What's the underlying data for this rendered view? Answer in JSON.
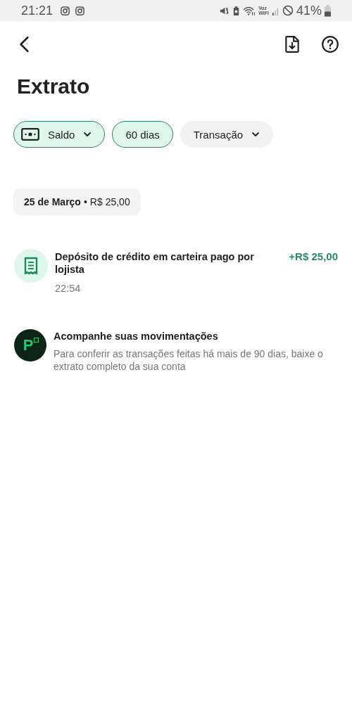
{
  "status_bar": {
    "time": "21:21",
    "network_label_top": "Voz",
    "network_label_bottom": "WIFI",
    "battery": "41%"
  },
  "header": {
    "title": "Extrato"
  },
  "filters": [
    {
      "kind": "balance",
      "label": "Saldo",
      "selected": true
    },
    {
      "kind": "period",
      "label": "60 dias",
      "selected": true
    },
    {
      "kind": "dropdown",
      "label": "Transação",
      "selected": false
    }
  ],
  "groups": [
    {
      "date": "25 de Março",
      "separator": "•",
      "total": "R$ 25,00",
      "transactions": [
        {
          "description": "Depósito de crédito em carteira pago por lojista",
          "amount": "+R$ 25,00",
          "time": "22:54"
        }
      ]
    }
  ],
  "notice": {
    "logo_letter": "P",
    "title": "Acompanhe suas movimentações",
    "text": "Para conferir as transações feitas há mais de 90 dias, baixe o extrato completo da sua conta"
  }
}
